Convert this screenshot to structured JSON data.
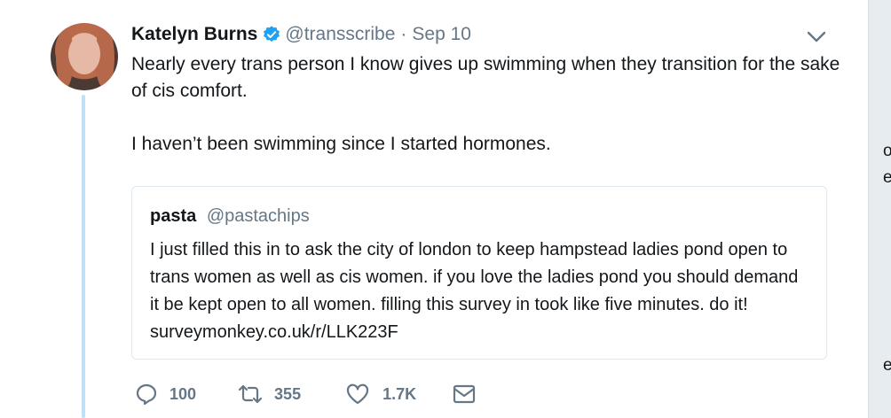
{
  "tweet": {
    "author_name": "Katelyn Burns",
    "handle": "@transscribe",
    "separator": "·",
    "date": "Sep 10",
    "text_paragraphs": [
      "Nearly every trans person I know gives up swimming when they transition for the sake of cis comfort.",
      "I haven’t been swimming since I started hormones."
    ],
    "replies": "100",
    "retweets": "355",
    "likes": "1.7K"
  },
  "quoted_tweet": {
    "author_name": "pasta",
    "handle": "@pastachips",
    "text": "I just filled this in to ask the city of london to keep hampstead ladies pond open to trans women as well as cis women. if you love the ladies pond you should demand it be kept open to all women. filling this survey in took like five minutes. do it! surveymonkey.co.uk/r/LLK223F"
  },
  "side_peek": {
    "line1": "o",
    "line2": "e",
    "line3": "e"
  },
  "colors": {
    "verified_blue": "#1da1f2",
    "thread_line": "#bfe1f5",
    "muted_text": "#657786",
    "border": "#e1e8ed"
  },
  "icons": [
    "verified-badge-icon",
    "chevron-down-icon",
    "reply-icon",
    "retweet-icon",
    "like-icon",
    "direct-message-icon"
  ]
}
